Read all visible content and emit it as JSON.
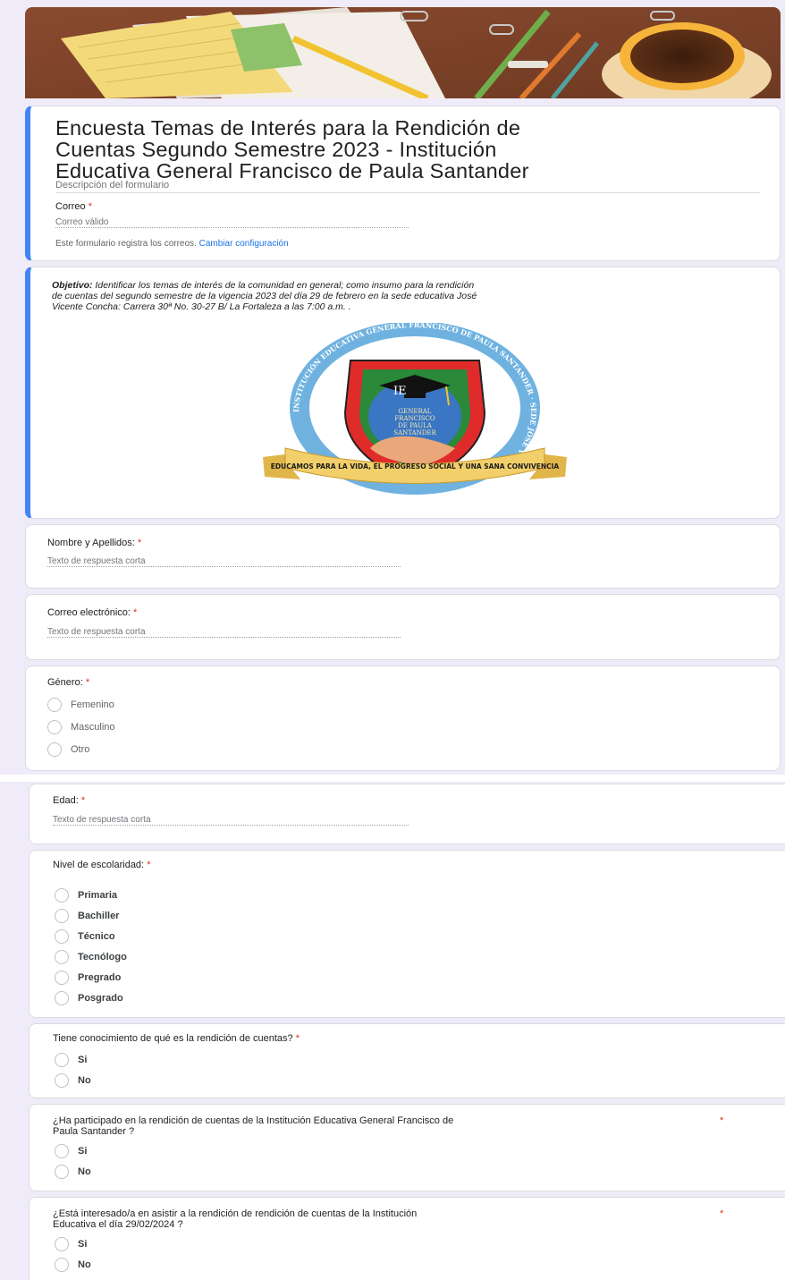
{
  "form": {
    "title_line1": "Encuesta Temas de Interés para la Rendición de",
    "title_line2": "Cuentas Segundo Semestre 2023 - Institución",
    "title_line3": "Educativa General Francisco de Paula Santander",
    "description_placeholder": "Descripción del formulario",
    "email_label": "Correo",
    "email_placeholder": "Correo válido",
    "email_note": "Este formulario registra los correos.",
    "email_note_link": "Cambiar configuración",
    "required_mark": "*"
  },
  "objective": {
    "label": "Objetivo:",
    "text1": " Identificar los temas de interés de la  comunidad en general; como insumo  para la rendición",
    "text2": "de cuentas del segundo semestre de la vigencia 2023 del día 29 de febrero en la sede educativa  José",
    "text3": "Vicente Concha: Carrera 30ª No. 30-27 B/ La Fortaleza a las 7:00 a.m.  .",
    "logo_ring_text": "INSTITUCIÓN EDUCATIVA GENERAL FRANCISCO DE PAULA SANTANDER · SEDE JOSÉ VICENTE CONCHA · ",
    "logo_ribbon": "EDUCAMOS PARA LA VIDA, EL PROGRESO SOCIAL Y UNA SANA CONVIVENCIA",
    "logo_ie": "IE",
    "logo_inner1": "GENERAL",
    "logo_inner2": "FRANCISCO",
    "logo_inner3": "DE PAULA",
    "logo_inner4": "SANTANDER"
  },
  "questions": {
    "name_label": "Nombre y Apellidos:",
    "short_answer": "Texto de respuesta corta",
    "email_label": "Correo electrónico:",
    "gender_label": "Género:",
    "gender_options": [
      "Femenino",
      "Masculino",
      "Otro"
    ],
    "age_label": "Edad:",
    "edu_label": "Nivel de escolaridad:",
    "edu_options": [
      "Primaria",
      "Bachiller",
      "Técnico",
      "Tecnólogo",
      "Pregrado",
      "Posgrado"
    ],
    "knows_label": "Tiene conocimiento de qué es la rendición de cuentas?",
    "yes": "Si",
    "no": "No",
    "participated_line1": "¿Ha participado en la rendición de cuentas de la Institución Educativa General Francisco de",
    "participated_line2": "Paula Santander ?",
    "interested_line1": "¿Está interesado/a  en asistir a la rendición de rendición de cuentas de la Institución",
    "interested_line2": "Educativa el día  29/02/2024 ?"
  },
  "colors": {
    "accent": "#4285f4",
    "required": "#d93025",
    "link": "#1a73e8",
    "background": "#f0ebf8"
  }
}
